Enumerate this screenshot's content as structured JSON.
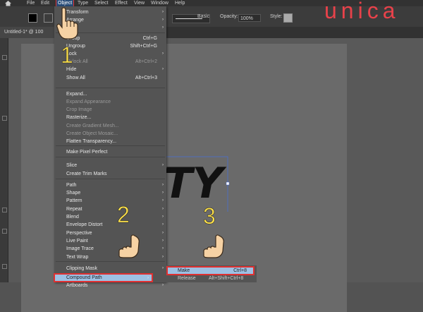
{
  "menubar": {
    "items": [
      "File",
      "Edit",
      "Object",
      "Type",
      "Select",
      "Effect",
      "View",
      "Window",
      "Help"
    ]
  },
  "toolbar": {
    "stroke_style": "Basic",
    "opacity_label": "Opacity:",
    "opacity_value": "100%",
    "style_label": "Style:"
  },
  "document": {
    "tab_title": "Untitled-1* @ 100"
  },
  "object_menu": {
    "items": [
      {
        "label": "Transform",
        "shortcut": "",
        "arrow": true,
        "disabled": false
      },
      {
        "label": "Arrange",
        "shortcut": "",
        "arrow": true,
        "disabled": false
      },
      {
        "label": "Align",
        "shortcut": "",
        "arrow": true,
        "disabled": false
      },
      {
        "label": "Group",
        "shortcut": "Ctrl+G",
        "arrow": false,
        "disabled": false
      },
      {
        "label": "Ungroup",
        "shortcut": "Shift+Ctrl+G",
        "arrow": false,
        "disabled": false
      },
      {
        "label": "Lock",
        "shortcut": "",
        "arrow": true,
        "disabled": false
      },
      {
        "label": "Unlock All",
        "shortcut": "Alt+Ctrl+2",
        "arrow": false,
        "disabled": true
      },
      {
        "label": "Hide",
        "shortcut": "",
        "arrow": true,
        "disabled": false
      },
      {
        "label": "Show All",
        "shortcut": "Alt+Ctrl+3",
        "arrow": false,
        "disabled": false
      },
      {
        "label": "Expand...",
        "shortcut": "",
        "arrow": false,
        "disabled": false
      },
      {
        "label": "Expand Appearance",
        "shortcut": "",
        "arrow": false,
        "disabled": true
      },
      {
        "label": "Crop Image",
        "shortcut": "",
        "arrow": false,
        "disabled": true
      },
      {
        "label": "Rasterize...",
        "shortcut": "",
        "arrow": false,
        "disabled": false
      },
      {
        "label": "Create Gradient Mesh...",
        "shortcut": "",
        "arrow": false,
        "disabled": true
      },
      {
        "label": "Create Object Mosaic...",
        "shortcut": "",
        "arrow": false,
        "disabled": true
      },
      {
        "label": "Flatten Transparency...",
        "shortcut": "",
        "arrow": false,
        "disabled": false
      },
      {
        "label": "Make Pixel Perfect",
        "shortcut": "",
        "arrow": false,
        "disabled": false
      },
      {
        "label": "Slice",
        "shortcut": "",
        "arrow": true,
        "disabled": false
      },
      {
        "label": "Create Trim Marks",
        "shortcut": "",
        "arrow": false,
        "disabled": false
      },
      {
        "label": "Path",
        "shortcut": "",
        "arrow": true,
        "disabled": false
      },
      {
        "label": "Shape",
        "shortcut": "",
        "arrow": true,
        "disabled": false
      },
      {
        "label": "Pattern",
        "shortcut": "",
        "arrow": true,
        "disabled": false
      },
      {
        "label": "Repeat",
        "shortcut": "",
        "arrow": true,
        "disabled": false
      },
      {
        "label": "Blend",
        "shortcut": "",
        "arrow": true,
        "disabled": false
      },
      {
        "label": "Envelope Distort",
        "shortcut": "",
        "arrow": true,
        "disabled": false
      },
      {
        "label": "Perspective",
        "shortcut": "",
        "arrow": true,
        "disabled": false
      },
      {
        "label": "Live Paint",
        "shortcut": "",
        "arrow": true,
        "disabled": false
      },
      {
        "label": "Image Trace",
        "shortcut": "",
        "arrow": true,
        "disabled": false
      },
      {
        "label": "Text Wrap",
        "shortcut": "",
        "arrow": true,
        "disabled": false
      },
      {
        "label": "Clipping Mask",
        "shortcut": "",
        "arrow": true,
        "disabled": false
      },
      {
        "label": "Compound Path",
        "shortcut": "",
        "arrow": true,
        "disabled": false
      },
      {
        "label": "Artboards",
        "shortcut": "",
        "arrow": true,
        "disabled": false
      }
    ]
  },
  "compound_submenu": {
    "make_label": "Make",
    "make_shortcut": "Ctrl+8",
    "release_label": "Release",
    "release_shortcut": "Alt+Shift+Ctrl+8"
  },
  "artboard": {
    "text": "TY"
  },
  "steps": {
    "step1": "1",
    "step2": "2",
    "step3": "3"
  },
  "logo": {
    "text": "unica"
  },
  "colors": {
    "highlight": "#9dc0e3",
    "callout_border": "#e03030",
    "step_number": "#ffe24a",
    "logo": "#e8424a"
  }
}
